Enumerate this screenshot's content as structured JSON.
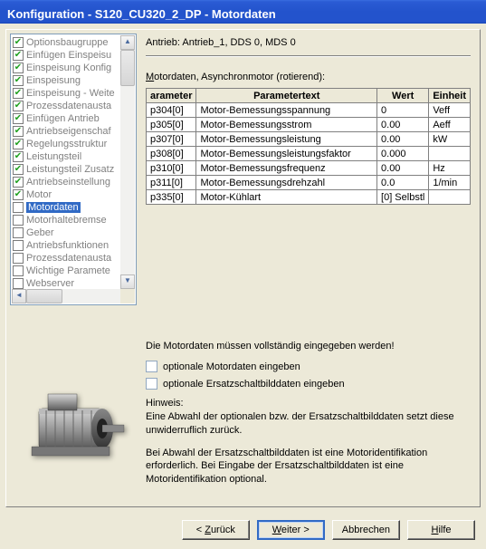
{
  "title": "Konfiguration - S120_CU320_2_DP - Motordaten",
  "tree": {
    "items": [
      {
        "label": "Optionsbaugruppe",
        "checked": true
      },
      {
        "label": "Einfügen Einspeisu",
        "checked": true
      },
      {
        "label": "Einspeisung Konfig",
        "checked": true
      },
      {
        "label": "Einspeisung",
        "checked": true
      },
      {
        "label": "Einspeisung - Weite",
        "checked": true
      },
      {
        "label": "Prozessdatenausta",
        "checked": true
      },
      {
        "label": "Einfügen Antrieb",
        "checked": true
      },
      {
        "label": "Antriebseigenschaf",
        "checked": true
      },
      {
        "label": "Regelungsstruktur",
        "checked": true
      },
      {
        "label": "Leistungsteil",
        "checked": true
      },
      {
        "label": "Leistungsteil Zusatz",
        "checked": true
      },
      {
        "label": "Antriebseinstellung",
        "checked": true
      },
      {
        "label": "Motor",
        "checked": true
      },
      {
        "label": "Motordaten",
        "checked": false,
        "selected": true
      },
      {
        "label": "Motorhaltebremse",
        "checked": false
      },
      {
        "label": "Geber",
        "checked": false
      },
      {
        "label": "Antriebsfunktionen",
        "checked": false
      },
      {
        "label": "Prozessdatenausta",
        "checked": false
      },
      {
        "label": "Wichtige Paramete",
        "checked": false
      },
      {
        "label": "Webserver",
        "checked": false
      }
    ]
  },
  "right": {
    "drive_line": "Antrieb: Antrieb_1, DDS 0, MDS 0",
    "section_pre": "M",
    "section_rest": "otordaten, Asynchronmotor (rotierend):",
    "headers": {
      "p": "arameter",
      "t": "Parametertext",
      "w": "Wert",
      "e": "Einheit"
    },
    "rows": [
      {
        "p": "p304[0]",
        "t": "Motor-Bemessungsspannung",
        "w": "0",
        "e": "Veff"
      },
      {
        "p": "p305[0]",
        "t": "Motor-Bemessungsstrom",
        "w": "0.00",
        "e": "Aeff"
      },
      {
        "p": "p307[0]",
        "t": "Motor-Bemessungsleistung",
        "w": "0.00",
        "e": "kW"
      },
      {
        "p": "p308[0]",
        "t": "Motor-Bemessungsleistungsfaktor",
        "w": "0.000",
        "e": ""
      },
      {
        "p": "p310[0]",
        "t": "Motor-Bemessungsfrequenz",
        "w": "0.00",
        "e": "Hz"
      },
      {
        "p": "p311[0]",
        "t": "Motor-Bemessungsdrehzahl",
        "w": "0.0",
        "e": "1/min"
      },
      {
        "p": "p335[0]",
        "t": "Motor-Kühlart",
        "w": "[0] Selbstl",
        "e": ""
      }
    ],
    "warn": "Die Motordaten müssen vollständig eingegeben werden!",
    "opt1_p": "o",
    "opt1_r": "ptionale Motordaten eingeben",
    "opt2_pre": "optionale ",
    "opt2_u": "E",
    "opt2_rest": "rsatzschaltbilddaten eingeben",
    "hint_title": "Hinweis:",
    "hint1": "Eine Abwahl der optionalen bzw. der Ersatzschaltbilddaten setzt diese unwiderruflich zurück.",
    "hint2": "Bei Abwahl der Ersatzschaltbilddaten ist eine Motoridentifikation erforderlich. Bei Eingabe der Ersatzschaltbilddaten ist eine Motoridentifikation optional."
  },
  "buttons": {
    "back_pre": "< ",
    "back_u": "Z",
    "back_rest": "urück",
    "next_u": "W",
    "next_rest": "eiter >",
    "cancel": "Abbrechen",
    "help_u": "H",
    "help_rest": "ilfe"
  }
}
